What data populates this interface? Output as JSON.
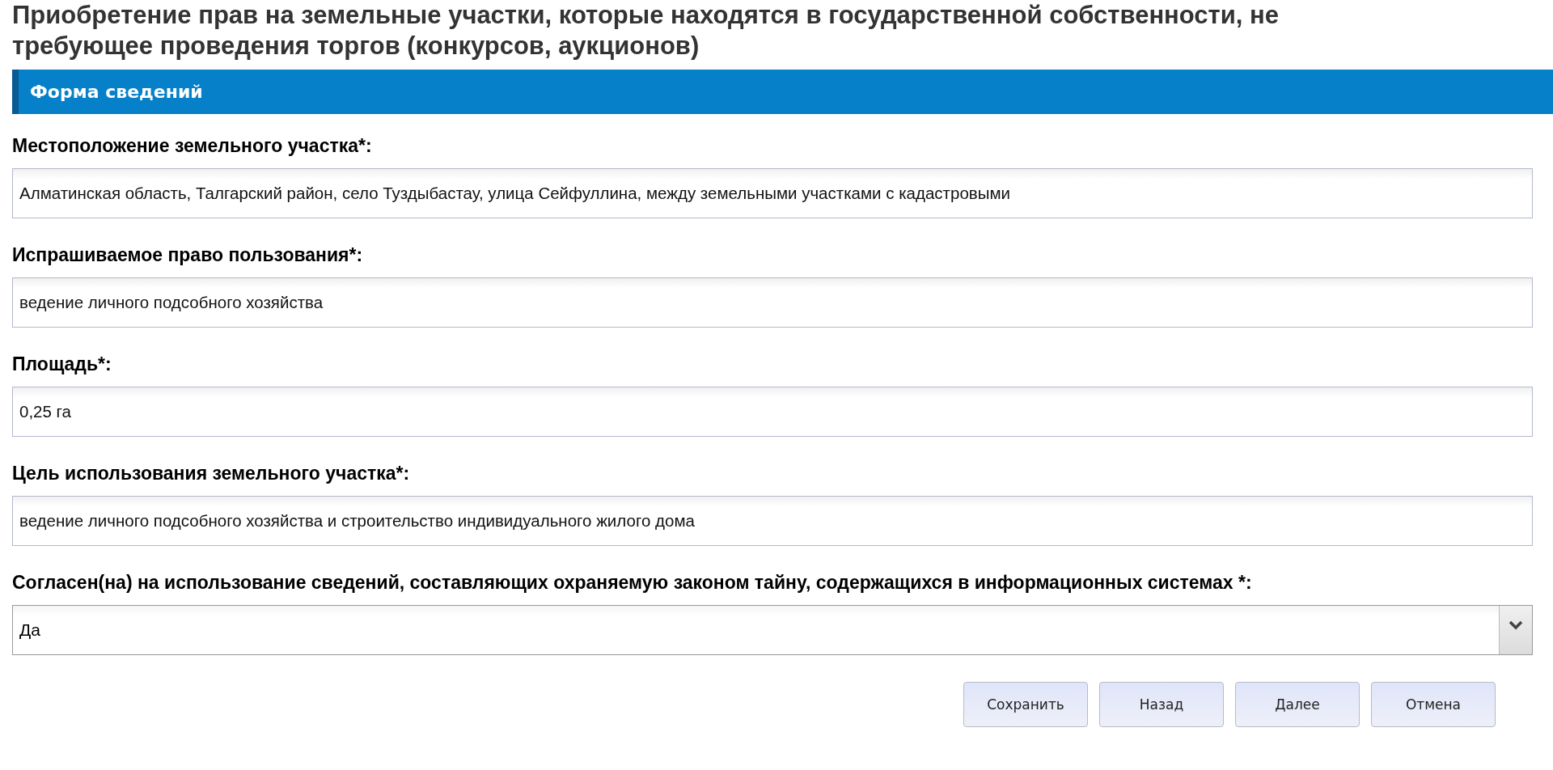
{
  "title": "Приобретение прав на земельные участки, которые находятся в государственной собственности, не требующее проведения торгов (конкурсов, аукционов)",
  "section_header": "Форма сведений",
  "fields": [
    {
      "kind": "text",
      "label": "Местоположение земельного участка*:",
      "value": "Алматинская область, Талгарский район, село Туздыбастау, улица Сейфуллина, между земельными участками с кадастровыми"
    },
    {
      "kind": "text",
      "label": "Испрашиваемое право пользования*:",
      "value": "ведение личного подсобного хозяйства"
    },
    {
      "kind": "text",
      "label": "Площадь*:",
      "value": "0,25 га"
    },
    {
      "kind": "text",
      "label": "Цель использования земельного участка*:",
      "value": "ведение личного подсобного хозяйства и строительство индивидуального жилого дома"
    },
    {
      "kind": "select",
      "label": "Согласен(на) на использование сведений, составляющих охраняемую законом тайну, содержащихся в информационных системах *:",
      "value": "Да"
    }
  ],
  "buttons": [
    "Сохранить",
    "Назад",
    "Далее",
    "Отмена"
  ]
}
